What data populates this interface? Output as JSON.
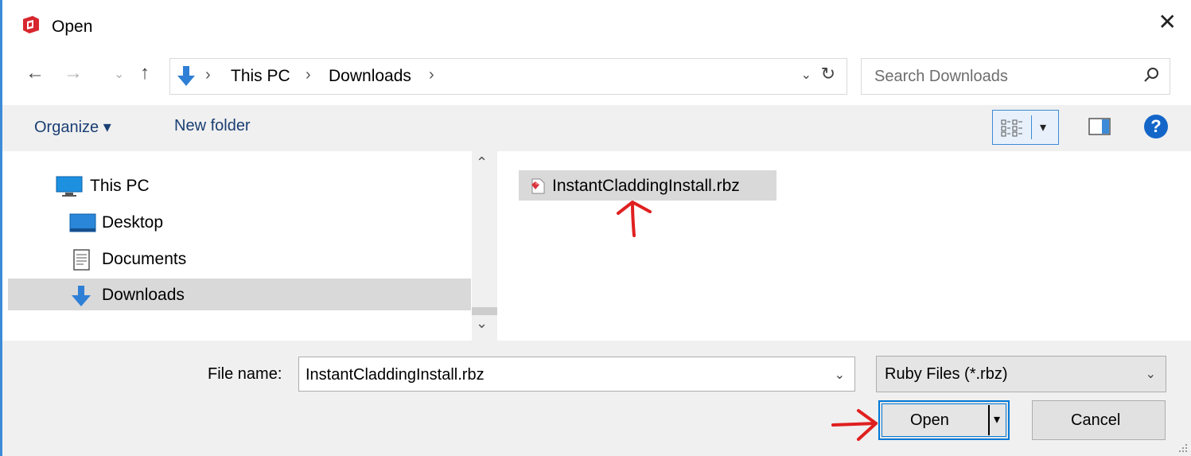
{
  "window": {
    "title": "Open",
    "close_glyph": "✕"
  },
  "nav": {
    "back_glyph": "←",
    "forward_glyph": "→",
    "recent_glyph": "⌄",
    "up_glyph": "↑",
    "breadcrumbs": [
      "This PC",
      "Downloads"
    ],
    "crumb_separator": "›",
    "dropdown_glyph": "⌄",
    "refresh_glyph": "↻",
    "search_placeholder": "Search Downloads"
  },
  "toolbar": {
    "organize_label": "Organize ▾",
    "new_folder_label": "New folder",
    "view_arrow": "▾",
    "help_glyph": "?"
  },
  "navpane": {
    "items": [
      {
        "label": "This PC",
        "icon": "computer-icon"
      },
      {
        "label": "Desktop",
        "icon": "desktop-folder-icon"
      },
      {
        "label": "Documents",
        "icon": "documents-icon"
      },
      {
        "label": "Downloads",
        "icon": "download-arrow-icon",
        "selected": true
      }
    ],
    "scroll_up": "⌃",
    "scroll_down": "⌄"
  },
  "files": [
    {
      "name": "InstantCladdingInstall.rbz",
      "icon": "ruby-file-icon",
      "selected": true
    }
  ],
  "bottom": {
    "file_name_label": "File name:",
    "file_name_value": "InstantCladdingInstall.rbz",
    "file_name_dd": "⌄",
    "file_type_value": "Ruby Files (*.rbz)",
    "file_type_dd": "⌄",
    "open_label": "Open",
    "open_arrow": "▾",
    "cancel_label": "Cancel"
  },
  "colors": {
    "accent": "#0078d7",
    "annotation": "#e02020",
    "selection": "#d9d9d9",
    "panel": "#f0f0f0"
  }
}
